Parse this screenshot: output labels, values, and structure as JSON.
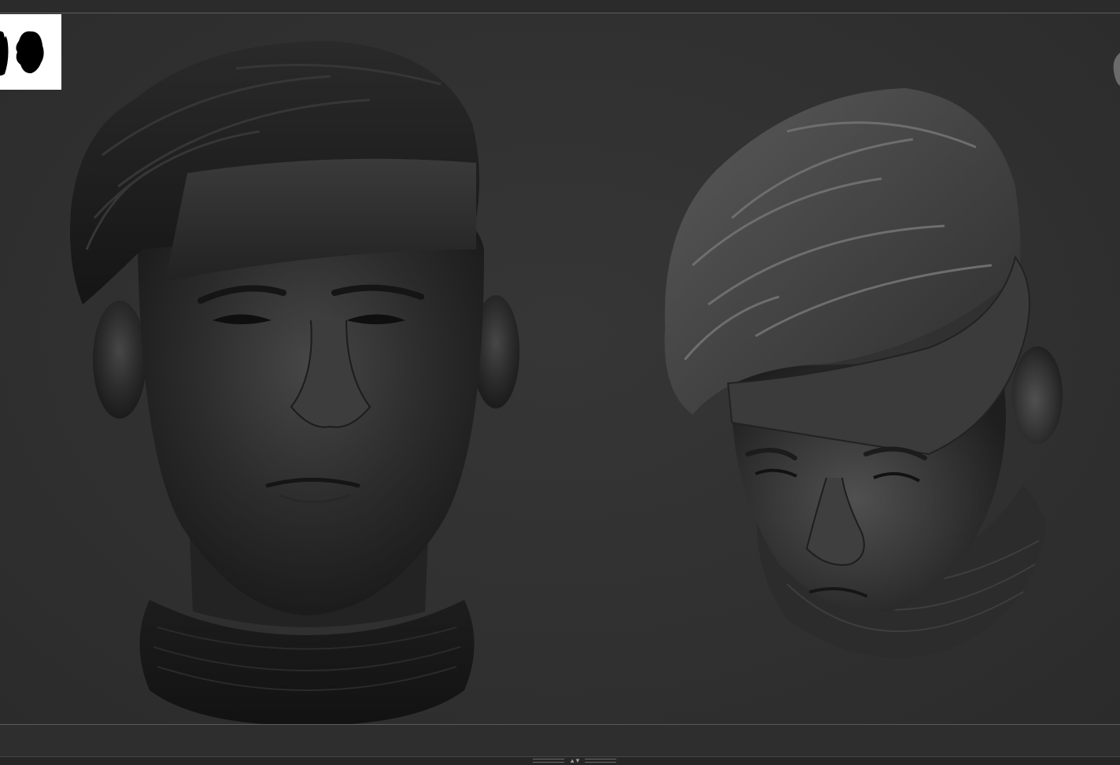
{
  "colors": {
    "background": "#2f2f2f",
    "viewport_border": "#5e5e5e",
    "model_dark": "#1e1e1e",
    "model_light": "#4a4a4a",
    "navigator_bg": "#ffffff"
  },
  "icons": {
    "navigator": "head-silhouettes-icon",
    "tray": "tray-collapse-arrows-icon"
  },
  "tray_handle": {
    "arrows": "▲▼"
  }
}
